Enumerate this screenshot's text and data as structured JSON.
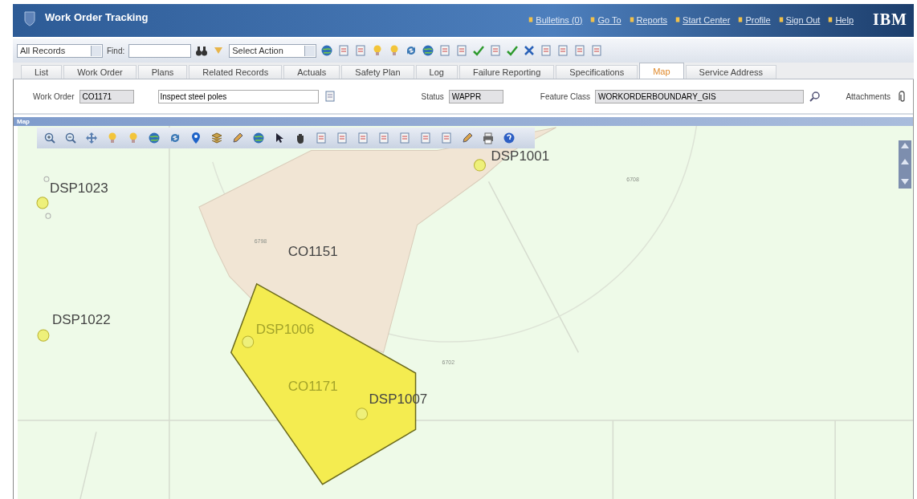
{
  "window": {
    "title": "Work Order Tracking",
    "logo": "IBM"
  },
  "header_links": [
    {
      "label": "Bulletins (0)"
    },
    {
      "label": "Go To"
    },
    {
      "label": "Reports"
    },
    {
      "label": "Start Center"
    },
    {
      "label": "Profile"
    },
    {
      "label": "Sign Out"
    },
    {
      "label": "Help"
    }
  ],
  "toolbar": {
    "query": "All Records",
    "find_label": "Find:",
    "action": "Select Action"
  },
  "tabs": [
    {
      "label": "List",
      "selected": false
    },
    {
      "label": "Work Order",
      "selected": false
    },
    {
      "label": "Plans",
      "selected": false
    },
    {
      "label": "Related Records",
      "selected": false
    },
    {
      "label": "Actuals",
      "selected": false
    },
    {
      "label": "Safety Plan",
      "selected": false
    },
    {
      "label": "Log",
      "selected": false
    },
    {
      "label": "Failure Reporting",
      "selected": false
    },
    {
      "label": "Specifications",
      "selected": false
    },
    {
      "label": "Map",
      "selected": true
    },
    {
      "label": "Service Address",
      "selected": false
    }
  ],
  "form": {
    "work_order": {
      "label": "Work Order",
      "value": "CO1171"
    },
    "description": {
      "value": "Inspect steel poles"
    },
    "status": {
      "label": "Status",
      "value": "WAPPR"
    },
    "feature_class": {
      "label": "Feature Class",
      "value": "WORKORDERBOUNDARY_GIS"
    },
    "attachments": {
      "label": "Attachments"
    }
  },
  "map": {
    "title": "Map",
    "areas": [
      {
        "label": "CO1151",
        "selected": false
      },
      {
        "label": "CO1171",
        "selected": true
      }
    ],
    "points": [
      {
        "label": "DSP1023"
      },
      {
        "label": "DSP1022"
      },
      {
        "label": "DSP1006"
      },
      {
        "label": "DSP1007"
      },
      {
        "label": "DSP1001"
      }
    ],
    "parcels": [
      "6798",
      "6708",
      "6702"
    ]
  }
}
